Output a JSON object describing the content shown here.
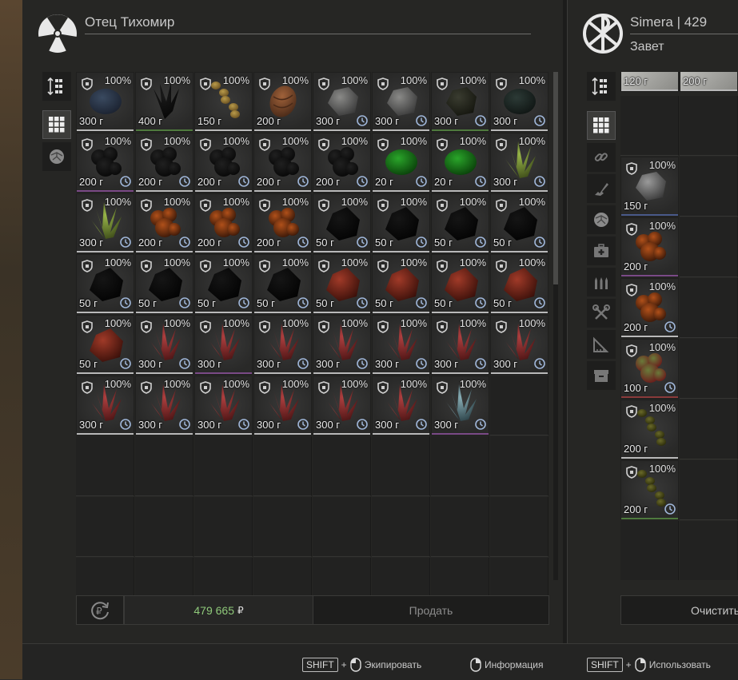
{
  "trader": {
    "name": "Отец Тихомир",
    "logo_icon": "radiation-icon"
  },
  "player": {
    "name": "Simera | 429",
    "faction": "Завет",
    "logo_icon": "chi-rho-icon"
  },
  "left_tabs": [
    {
      "icon": "sort-icon",
      "active": false
    },
    {
      "icon": "grid-icon",
      "active": true
    },
    {
      "icon": "artifact-icon",
      "active": false
    }
  ],
  "right_tabs": [
    {
      "icon": "sort-icon",
      "active": false
    },
    {
      "icon": "grid-icon",
      "active": true
    },
    {
      "icon": "link-icon",
      "active": false
    },
    {
      "icon": "weapon-icon",
      "active": false
    },
    {
      "icon": "artifact-icon",
      "active": false
    },
    {
      "icon": "medkit-icon",
      "active": false
    },
    {
      "icon": "ammo-icon",
      "active": false
    },
    {
      "icon": "tools-icon",
      "active": false
    },
    {
      "icon": "ruler-icon",
      "active": false
    },
    {
      "icon": "box-icon",
      "active": false
    }
  ],
  "trader_items": [
    {
      "dur": "100%",
      "price": "300 г",
      "clock": false,
      "art": "dark-blue-artifact",
      "bar": "white"
    },
    {
      "dur": "100%",
      "price": "400 г",
      "clock": false,
      "art": "black-spiky-artifact",
      "bar": "green"
    },
    {
      "dur": "100%",
      "price": "150 г",
      "clock": false,
      "art": "sausage-chain-artifact",
      "bar": "white"
    },
    {
      "dur": "100%",
      "price": "200 г",
      "clock": false,
      "art": "brown-shell-artifact",
      "bar": "white"
    },
    {
      "dur": "100%",
      "price": "300 г",
      "clock": true,
      "art": "grey-rock-artifact",
      "bar": "white"
    },
    {
      "dur": "100%",
      "price": "300 г",
      "clock": true,
      "art": "grey-rock-artifact",
      "bar": "white"
    },
    {
      "dur": "100%",
      "price": "300 г",
      "clock": true,
      "art": "dark-lump-artifact",
      "bar": "green"
    },
    {
      "dur": "100%",
      "price": "300 г",
      "clock": true,
      "art": "dark-teal-artifact",
      "bar": "white"
    },
    {
      "dur": "100%",
      "price": "200 г",
      "clock": true,
      "art": "black-cluster-artifact",
      "bar": "purple"
    },
    {
      "dur": "100%",
      "price": "200 г",
      "clock": true,
      "art": "black-cluster-artifact",
      "bar": "white"
    },
    {
      "dur": "100%",
      "price": "200 г",
      "clock": true,
      "art": "black-cluster-artifact",
      "bar": "white"
    },
    {
      "dur": "100%",
      "price": "200 г",
      "clock": true,
      "art": "black-cluster-artifact",
      "bar": "white"
    },
    {
      "dur": "100%",
      "price": "200 г",
      "clock": true,
      "art": "black-cluster-artifact",
      "bar": "white"
    },
    {
      "dur": "100%",
      "price": "20 г",
      "clock": true,
      "art": "green-blob-artifact",
      "bar": "white"
    },
    {
      "dur": "100%",
      "price": "20 г",
      "clock": true,
      "art": "green-blob-artifact",
      "bar": "white"
    },
    {
      "dur": "100%",
      "price": "300 г",
      "clock": true,
      "art": "green-crystal-artifact",
      "bar": "white"
    },
    {
      "dur": "100%",
      "price": "300 г",
      "clock": true,
      "art": "green-crystal-artifact",
      "bar": "white"
    },
    {
      "dur": "100%",
      "price": "200 г",
      "clock": true,
      "art": "orange-flame-artifact",
      "bar": "white"
    },
    {
      "dur": "100%",
      "price": "200 г",
      "clock": true,
      "art": "orange-flame-artifact",
      "bar": "white"
    },
    {
      "dur": "100%",
      "price": "200 г",
      "clock": true,
      "art": "orange-flame-artifact",
      "bar": "white"
    },
    {
      "dur": "100%",
      "price": "50 г",
      "clock": true,
      "art": "black-stone-artifact",
      "bar": "white"
    },
    {
      "dur": "100%",
      "price": "50 г",
      "clock": true,
      "art": "black-stone-artifact",
      "bar": "white"
    },
    {
      "dur": "100%",
      "price": "50 г",
      "clock": true,
      "art": "black-stone-artifact",
      "bar": "white"
    },
    {
      "dur": "100%",
      "price": "50 г",
      "clock": true,
      "art": "black-stone-artifact",
      "bar": "white"
    },
    {
      "dur": "100%",
      "price": "50 г",
      "clock": true,
      "art": "black-stone-artifact",
      "bar": "white"
    },
    {
      "dur": "100%",
      "price": "50 г",
      "clock": true,
      "art": "black-stone-artifact",
      "bar": "white"
    },
    {
      "dur": "100%",
      "price": "50 г",
      "clock": true,
      "art": "black-stone-artifact",
      "bar": "white"
    },
    {
      "dur": "100%",
      "price": "50 г",
      "clock": true,
      "art": "black-stone-artifact",
      "bar": "white"
    },
    {
      "dur": "100%",
      "price": "50 г",
      "clock": true,
      "art": "red-meat-artifact",
      "bar": "white"
    },
    {
      "dur": "100%",
      "price": "50 г",
      "clock": true,
      "art": "red-meat-artifact",
      "bar": "white"
    },
    {
      "dur": "100%",
      "price": "50 г",
      "clock": true,
      "art": "red-meat-artifact",
      "bar": "white"
    },
    {
      "dur": "100%",
      "price": "50 г",
      "clock": true,
      "art": "red-meat-artifact",
      "bar": "white"
    },
    {
      "dur": "100%",
      "price": "50 г",
      "clock": true,
      "art": "red-meat-artifact",
      "bar": "white"
    },
    {
      "dur": "100%",
      "price": "300 г",
      "clock": true,
      "art": "red-crystal-artifact",
      "bar": "white"
    },
    {
      "dur": "100%",
      "price": "300 г",
      "clock": false,
      "art": "red-crystal-artifact",
      "bar": "purple"
    },
    {
      "dur": "100%",
      "price": "300 г",
      "clock": true,
      "art": "red-crystal-artifact",
      "bar": "white"
    },
    {
      "dur": "100%",
      "price": "300 г",
      "clock": true,
      "art": "red-crystal-artifact",
      "bar": "white"
    },
    {
      "dur": "100%",
      "price": "300 г",
      "clock": true,
      "art": "red-crystal-artifact",
      "bar": "white"
    },
    {
      "dur": "100%",
      "price": "300 г",
      "clock": true,
      "art": "red-crystal-artifact",
      "bar": "white"
    },
    {
      "dur": "100%",
      "price": "300 г",
      "clock": true,
      "art": "red-crystal-artifact",
      "bar": "white"
    },
    {
      "dur": "100%",
      "price": "300 г",
      "clock": true,
      "art": "red-crystal-artifact",
      "bar": "white"
    },
    {
      "dur": "100%",
      "price": "300 г",
      "clock": true,
      "art": "red-crystal-artifact",
      "bar": "white"
    },
    {
      "dur": "100%",
      "price": "300 г",
      "clock": true,
      "art": "red-crystal-artifact",
      "bar": "white"
    },
    {
      "dur": "100%",
      "price": "300 г",
      "clock": true,
      "art": "red-crystal-artifact",
      "bar": "white"
    },
    {
      "dur": "100%",
      "price": "300 г",
      "clock": true,
      "art": "red-crystal-artifact",
      "bar": "white"
    },
    {
      "dur": "100%",
      "price": "300 г",
      "clock": true,
      "art": "red-crystal-artifact",
      "bar": "white"
    },
    {
      "dur": "100%",
      "price": "300 г",
      "clock": true,
      "art": "pale-blue-crystal-artifact",
      "bar": "purple"
    }
  ],
  "player_top_items": [
    {
      "price": "120 г"
    },
    {
      "price": "200 г"
    }
  ],
  "player_items": [
    {
      "dur": "100%",
      "price": "150 г",
      "clock": false,
      "art": "grey-cloth-artifact",
      "bar": "blue"
    },
    {
      "dur": "100%",
      "price": "200 г",
      "clock": false,
      "art": "orange-flame-artifact",
      "bar": "purple"
    },
    {
      "dur": "100%",
      "price": "200 г",
      "clock": true,
      "art": "orange-flame-artifact",
      "bar": "white"
    },
    {
      "dur": "100%",
      "price": "100 г",
      "clock": true,
      "art": "red-green-artifact",
      "bar": "red"
    },
    {
      "dur": "100%",
      "price": "200 г",
      "clock": false,
      "art": "olive-berries-artifact",
      "bar": "white"
    },
    {
      "dur": "100%",
      "price": "200 г",
      "clock": true,
      "art": "olive-berries-artifact",
      "bar": "green"
    }
  ],
  "trade": {
    "total": "479 665",
    "currency": "₽",
    "sell_label": "Продать",
    "clear_label": "Очистить",
    "reset_icon": "ruble-cycle-icon"
  },
  "hints": [
    {
      "key": "SHIFT",
      "plus": "+",
      "label": "Экипировать",
      "icon": "mouse-left-icon"
    },
    {
      "key": "",
      "plus": "",
      "label": "Информация",
      "icon": "mouse-right-icon"
    },
    {
      "key": "SHIFT",
      "plus": "+",
      "label": "Использовать",
      "icon": "mouse-right-icon"
    }
  ],
  "colors": {
    "sum_green": "#8fc97a",
    "bar_white": "#b9b9b9",
    "bar_green": "#4f7a3e",
    "bar_purple": "#7a4a86"
  }
}
